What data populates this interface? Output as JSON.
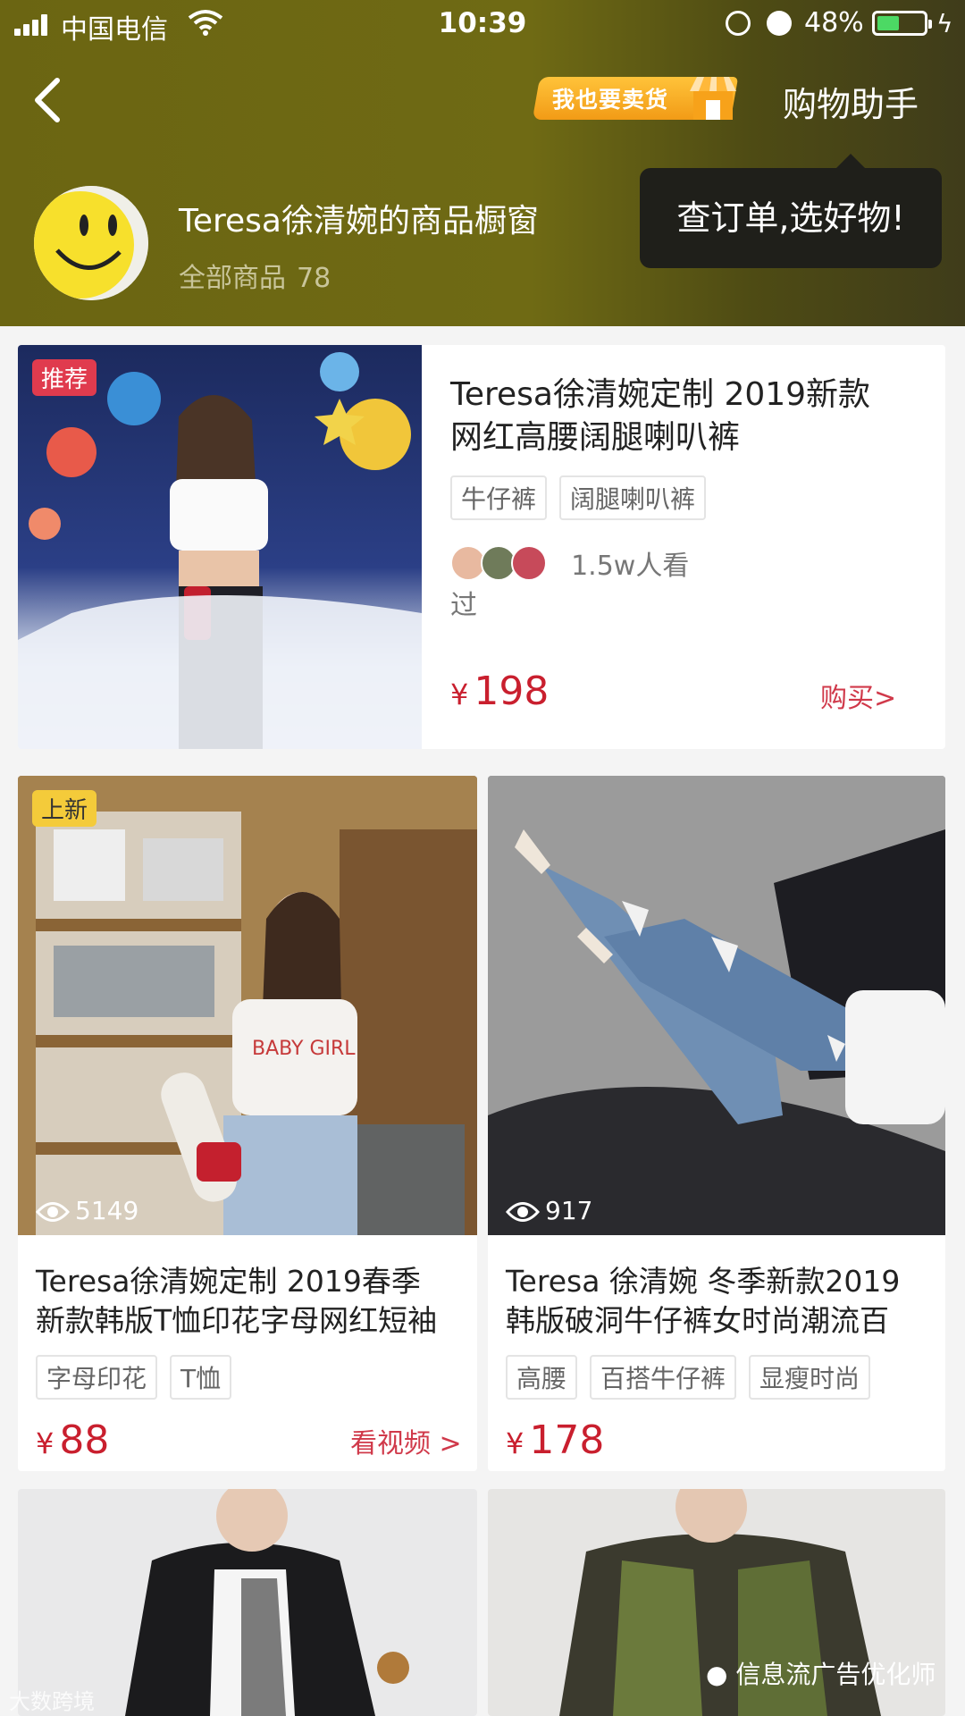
{
  "status_bar": {
    "carrier": "中国电信",
    "time": "10:39",
    "battery_percent": "48%",
    "battery_level": 0.48
  },
  "header": {
    "back_icon": "chevron-left-icon",
    "sell_badge": "我也要卖货",
    "assistant": "购物助手",
    "shop_title": "Teresa徐清婉的商品橱窗",
    "all_products_label": "全部商品",
    "all_products_count": "78",
    "tooltip": "查订单,选好物!"
  },
  "products": [
    {
      "badge": "推荐",
      "title_line1": "Teresa徐清婉定制  2019新款",
      "title_line2": "网红高腰阔腿喇叭裤",
      "tags": [
        "牛仔裤",
        "阔腿喇叭裤"
      ],
      "viewers": "1.5w人看过",
      "currency": "¥",
      "price": "198",
      "cta": "购买>"
    },
    {
      "badge": "上新",
      "views": "5149",
      "title_line1": "Teresa徐清婉定制  2019春季",
      "title_line2": "新款韩版T恤印花字母网红短袖",
      "tags": [
        "字母印花",
        "T恤"
      ],
      "currency": "¥",
      "price": "88",
      "cta": "看视频 >"
    },
    {
      "views": "917",
      "title_line1": "Teresa 徐清婉 冬季新款2019",
      "title_line2": "韩版破洞牛仔裤女时尚潮流百",
      "tags": [
        "高腰",
        "百搭牛仔裤",
        "显瘦时尚"
      ],
      "currency": "¥",
      "price": "178"
    }
  ],
  "watermarks": {
    "left": "大数跨境",
    "right": "信息流广告优化师"
  },
  "colors": {
    "header_bg": "#6b6512",
    "price_red": "#c91f2e",
    "accent_orange": "#f29b16"
  }
}
